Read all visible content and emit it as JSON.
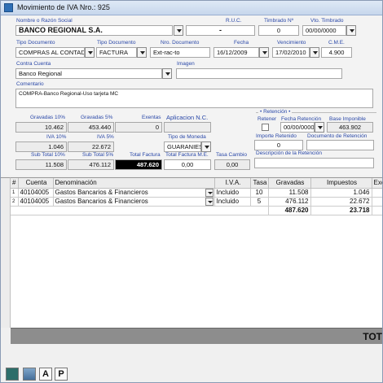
{
  "window": {
    "title": "Movimiento de IVA Nro.: 925"
  },
  "form": {
    "nombre_label": "Nombre o Razón Social",
    "nombre_value": "BANCO REGIONAL S.A.",
    "ruc_label": "R.U.C.",
    "ruc_value": "-",
    "timbrado_label": "Timbrado Nº",
    "timbrado_value": "0",
    "vto_timbrado_label": "Vto. Timbrado",
    "vto_timbrado_value": "00/00/0000",
    "tipo_doc_label": "Tipo Documento",
    "tipo_doc_value": "COMPRAS AL CONTADO",
    "tipo_doc2_label": "Tipo Documento",
    "tipo_doc2_value": "FACTURA",
    "nro_doc_label": "Nro. Documento",
    "nro_doc_value": "Ext-rac-to",
    "fecha_label": "Fecha",
    "fecha_value": "16/12/2009",
    "vencimiento_label": "Vencimiento",
    "vencimiento_value": "17/02/2010",
    "cme_label": "C.M.E.",
    "cme_value": "4.900",
    "contra_cuenta_label": "Contra Cuenta",
    "contra_cuenta_value": "Banco Regional",
    "imagen_label": "Imagen",
    "imagen_value": "",
    "comentario_label": "Comentario",
    "comentario_value": "COMPRA-Banco Regional-Uso tarjeta MC"
  },
  "amounts": {
    "gravadas10_label": "Gravadas 10%",
    "gravadas10_value": "10.462",
    "gravadas5_label": "Gravadas 5%",
    "gravadas5_value": "453.440",
    "exentas_label": "Exentas",
    "exentas_value": "0",
    "aplicacion_label": "Aplicacion N.C.",
    "aplicacion_value": "",
    "iva10_label": "IVA 10%",
    "iva10_value": "1.046",
    "iva5_label": "IVA 5%",
    "iva5_value": "22.672",
    "tipo_moneda_label": "Tipo de Moneda",
    "tipo_moneda_value": "GUARANIES",
    "subtotal10_label": "Sub Total 10%",
    "subtotal10_value": "11.508",
    "subtotal5_label": "Sub Total 5%",
    "subtotal5_value": "476.112",
    "total_factura_label": "Total Factura",
    "total_factura_value": "487.620",
    "total_me_label": "Total Factura M.E.",
    "total_me_value": "0,00",
    "tasa_cambio_label": "Tasa Cambio",
    "tasa_cambio_value": "0,00"
  },
  "retencion": {
    "section_label": "• Retención •",
    "retener_label": "Retener",
    "retener_checked": false,
    "fecha_ret_label": "Fecha Retención",
    "fecha_ret_value": "00/00/0000",
    "base_imponible_label": "Base Imponible",
    "base_imponible_value": "463.902",
    "importe_ret_label": "Importe Retenido",
    "importe_ret_value": "0",
    "documento_ret_label": "Documento de Retención",
    "documento_ret_value": "",
    "descripcion_ret_label": "Descripción de la Retención",
    "descripcion_ret_value": ""
  },
  "grid": {
    "columns": [
      "#",
      "Cuenta",
      "Denominación",
      "I.V.A.",
      "Tasa",
      "Gravadas",
      "Impuestos",
      "Exen"
    ],
    "rows": [
      [
        "1",
        "40104005",
        "Gastos Bancarios & Financieros",
        "Incluido",
        "10",
        "11.508",
        "1.046",
        ""
      ],
      [
        "2",
        "40104005",
        "Gastos Bancarios & Financieros",
        "Incluido",
        "5",
        "476.112",
        "22.672",
        ""
      ]
    ],
    "sum_gravadas": "487.620",
    "sum_impuestos": "23.718"
  },
  "totals_bar": {
    "label": "TOT"
  },
  "footer": {
    "btn_a": "A",
    "btn_p": "P",
    "icon1": "exit-icon",
    "icon2": "calculator-icon"
  }
}
